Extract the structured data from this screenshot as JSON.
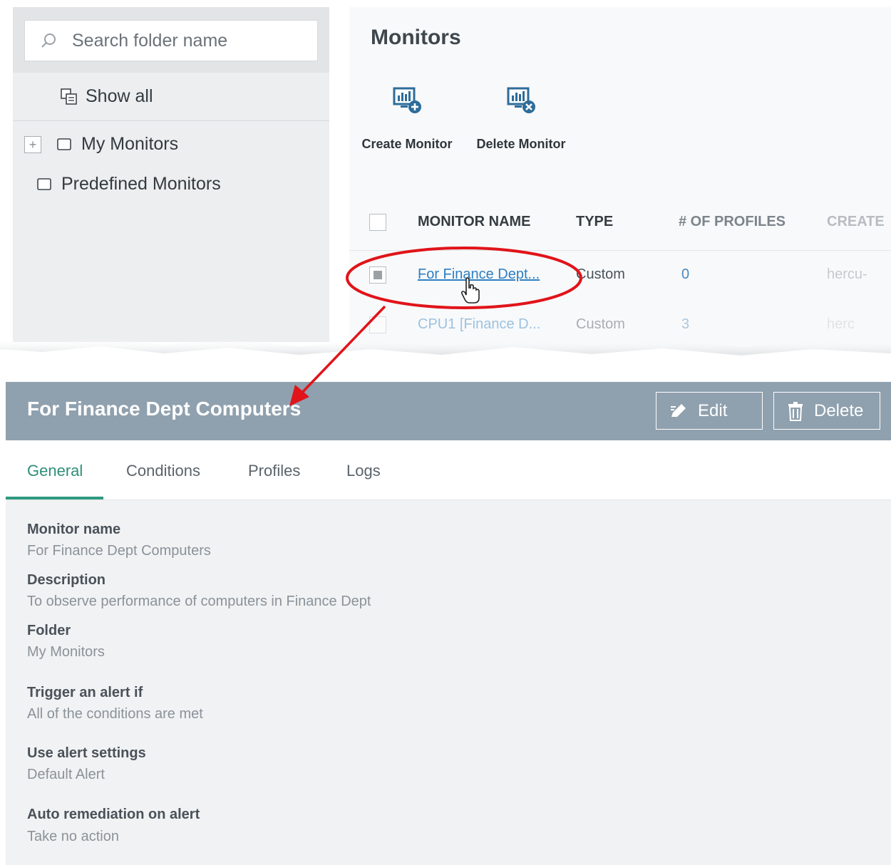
{
  "folders": {
    "search_placeholder": "Search folder name",
    "show_all": "Show all",
    "items": [
      {
        "label": "My Monitors"
      },
      {
        "label": "Predefined Monitors"
      }
    ]
  },
  "monitors": {
    "title": "Monitors",
    "toolbar": {
      "create": "Create Monitor",
      "delete": "Delete Monitor"
    },
    "columns": [
      "MONITOR NAME",
      "TYPE",
      "# OF PROFILES",
      "CREATE"
    ],
    "rows": [
      {
        "name": "For Finance Dept...",
        "type": "Custom",
        "profiles": "0",
        "created_by": "hercu-"
      },
      {
        "name": "CPU1 [Finance D...",
        "type": "Custom",
        "profiles": "3",
        "created_by": "herc"
      }
    ]
  },
  "detail": {
    "title": "For Finance Dept Computers",
    "edit_label": "Edit",
    "delete_label": "Delete",
    "tabs": [
      "General",
      "Conditions",
      "Profiles",
      "Logs"
    ],
    "fields": [
      {
        "label": "Monitor name",
        "value": "For Finance Dept Computers"
      },
      {
        "label": "Description",
        "value": "To observe performance of computers in Finance Dept"
      },
      {
        "label": "Folder",
        "value": "My Monitors"
      },
      {
        "label": "Trigger an alert if",
        "value": "All of the conditions are met"
      },
      {
        "label": "Use alert settings",
        "value": "Default Alert"
      },
      {
        "label": "Auto remediation on alert",
        "value": "Take no action"
      }
    ]
  },
  "colors": {
    "header_bg": "#8fa0ae",
    "link": "#2e7fc2",
    "active_tab": "#2e8f78",
    "annotation": "#e0141a"
  }
}
